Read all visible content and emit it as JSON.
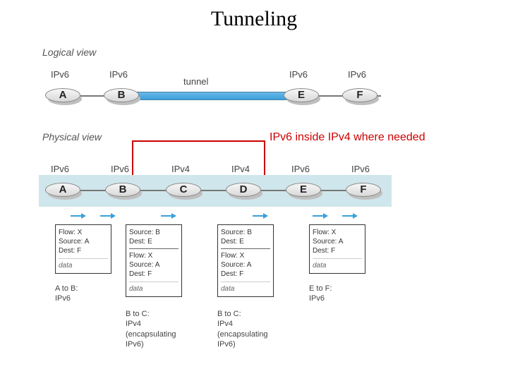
{
  "title": "Tunneling",
  "logical": {
    "label": "Logical view",
    "tunnel": "tunnel",
    "nodes": [
      {
        "letter": "A",
        "proto": "IPv6"
      },
      {
        "letter": "B",
        "proto": "IPv6"
      },
      {
        "letter": "E",
        "proto": "IPv6"
      },
      {
        "letter": "F",
        "proto": "IPv6"
      }
    ]
  },
  "annotation": "IPv6 inside IPv4 where needed",
  "physical": {
    "label": "Physical view",
    "nodes": [
      {
        "letter": "A",
        "proto": "IPv6"
      },
      {
        "letter": "B",
        "proto": "IPv6"
      },
      {
        "letter": "C",
        "proto": "IPv4"
      },
      {
        "letter": "D",
        "proto": "IPv4"
      },
      {
        "letter": "E",
        "proto": "IPv6"
      },
      {
        "letter": "F",
        "proto": "IPv6"
      }
    ]
  },
  "packets": {
    "ab": {
      "flow": "Flow: X",
      "src": "Source: A",
      "dst": "Dest: F",
      "data": "data",
      "caption1": "A to B:",
      "caption2": "IPv6"
    },
    "bc": {
      "outer_src": "Source: B",
      "outer_dst": "Dest: E",
      "inner_flow": "Flow: X",
      "inner_src": "Source: A",
      "inner_dst": "Dest: F",
      "data": "data",
      "caption1": "B to C:",
      "caption2": "IPv4",
      "caption3": "(encapsulating",
      "caption4": "IPv6)"
    },
    "bc2": {
      "outer_src": "Source: B",
      "outer_dst": "Dest: E",
      "inner_flow": "Flow: X",
      "inner_src": "Source: A",
      "inner_dst": "Dest: F",
      "data": "data",
      "caption1": "B to C:",
      "caption2": "IPv4",
      "caption3": "(encapsulating",
      "caption4": "IPv6)"
    },
    "ef": {
      "flow": "Flow: X",
      "src": "Source: A",
      "dst": "Dest: F",
      "data": "data",
      "caption1": "E to F:",
      "caption2": "IPv6"
    }
  }
}
